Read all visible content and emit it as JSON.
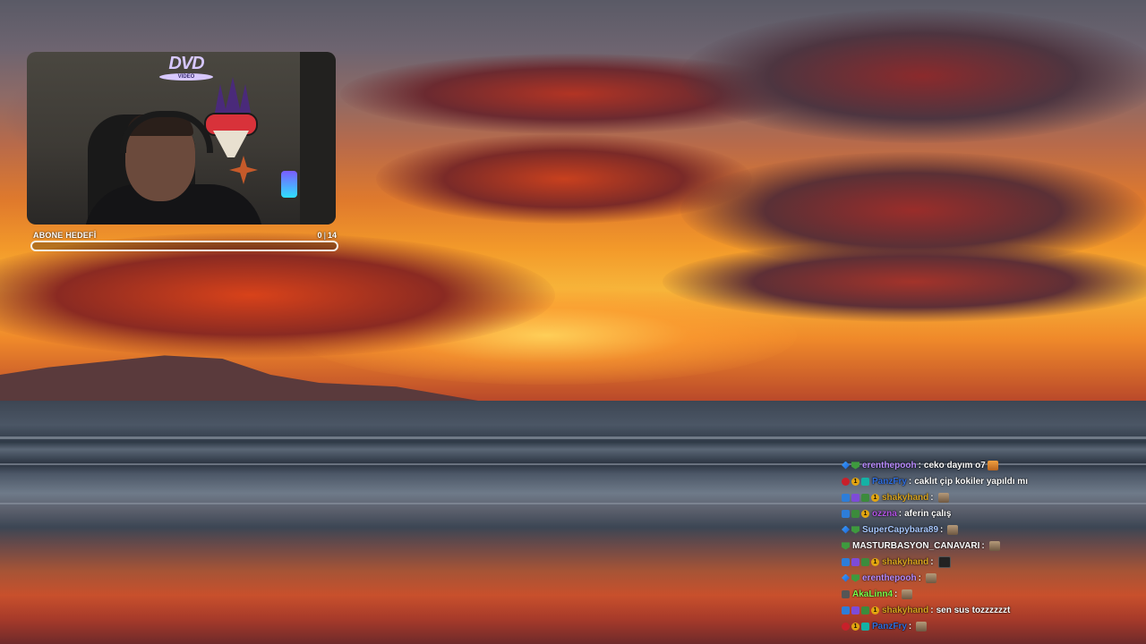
{
  "overlay": {
    "dvd_logo": {
      "brand": "DVD",
      "sub": "VIDEO"
    },
    "goal": {
      "title": "ABONE HEDEFİ",
      "current": "0",
      "target": "14",
      "progress": 0.0
    }
  },
  "chat": {
    "messages": [
      {
        "badges": [
          "bits",
          "sub"
        ],
        "username": "erenthepooh",
        "color": "#b98cff",
        "text": "ceko dayım o7",
        "emote": "cat"
      },
      {
        "badges": [
          "red",
          "one",
          "teal"
        ],
        "username": "PanzFry",
        "color": "#2f6fe0",
        "text": "caklıt çip kokiler yapıldı mı",
        "emote": ""
      },
      {
        "badges": [
          "blue",
          "purple",
          "green",
          "one"
        ],
        "username": "shakyhand",
        "color": "#d9a520",
        "text": "",
        "emote": "plain"
      },
      {
        "badges": [
          "blue",
          "green",
          "one"
        ],
        "username": "ozzna",
        "color": "#b455e6",
        "text": "aferin çalış",
        "emote": ""
      },
      {
        "badges": [
          "bits",
          "sub"
        ],
        "username": "SuperCapybara89",
        "color": "#a8c8ff",
        "text": "",
        "emote": "plain"
      },
      {
        "badges": [
          "sub"
        ],
        "username": "MASTURBASYON_CANAVARI",
        "color": "#ffffff",
        "text": "",
        "emote": "plain"
      },
      {
        "badges": [
          "blue",
          "purple",
          "green",
          "one"
        ],
        "username": "shakyhand",
        "color": "#d9a520",
        "text": "",
        "emote": "dark"
      },
      {
        "badges": [
          "bits",
          "sub"
        ],
        "username": "erenthepooh",
        "color": "#b98cff",
        "text": "",
        "emote": "plain"
      },
      {
        "badges": [
          "gray"
        ],
        "username": "AkaLinn4",
        "color": "#7cff4a",
        "text": "",
        "emote": "plain"
      },
      {
        "badges": [
          "blue",
          "purple",
          "green",
          "one"
        ],
        "username": "shakyhand",
        "color": "#d9a520",
        "text": "sen sus tozzzzzzt",
        "emote": ""
      },
      {
        "badges": [
          "red",
          "one",
          "teal"
        ],
        "username": "PanzFry",
        "color": "#2f6fe0",
        "text": "",
        "emote": "plain"
      }
    ]
  }
}
